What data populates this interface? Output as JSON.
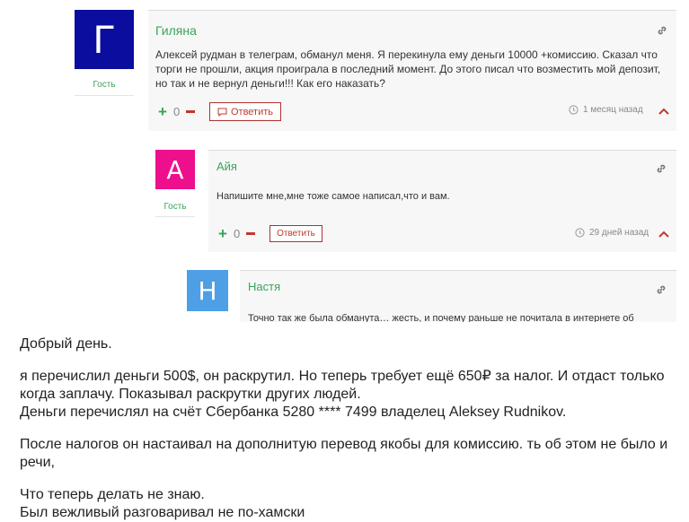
{
  "comments": [
    {
      "avatar_letter": "Г",
      "avatar_color": "#0a0d9e",
      "role": "Гость",
      "author": "Гиляна",
      "text": "Алексей рудман в телеграм, обманул меня. Я перекинула ему деньги 10000 +комиссию. Сказал что торги не прошли, акция проиграла в последний момент. До этого писал что возместить мой депозит, но так и не вернул деньги!!! Как его наказать?",
      "votes": "0",
      "reply_label": "Ответить",
      "time": "1 месяц назад"
    },
    {
      "avatar_letter": "А",
      "avatar_color": "#ee0f8d",
      "role": "Гость",
      "author": "Айя",
      "text": "Напишите мне,мне тоже самое написал,что и вам.",
      "votes": "0",
      "reply_label": "Ответить",
      "time": "29 дней назад"
    },
    {
      "avatar_letter": "Н",
      "avatar_color": "#4f9fe6",
      "author": "Настя",
      "text": "Точно так же была обманута… жесть, и почему раньше не почитала в интернете об"
    }
  ],
  "post": {
    "p1": "Добрый день.",
    "p2_l1": "я перечислил деньги 500$, он раскрутил. Но теперь требует ещё 650₽ за налог. И отдаст только",
    "p2_l2": "когда заплачу. Показывал раскрутки других людей.",
    "p2_l3": "Деньги перечислял на счёт Сбербанка 5280 **** 7499 владелец Aleksey Rudnikov.",
    "p3_l1": "После налогов он настаивал на дополнитую перевод якобы для комиссию. ть об этом не было и",
    "p3_l2": "речи,",
    "p4_l1": "Что теперь делать не знаю.",
    "p4_l2": "Был вежливый разговаривал не по-хамски"
  },
  "colors": {
    "accent_green": "#3aa35b",
    "accent_red": "#c0392b"
  }
}
